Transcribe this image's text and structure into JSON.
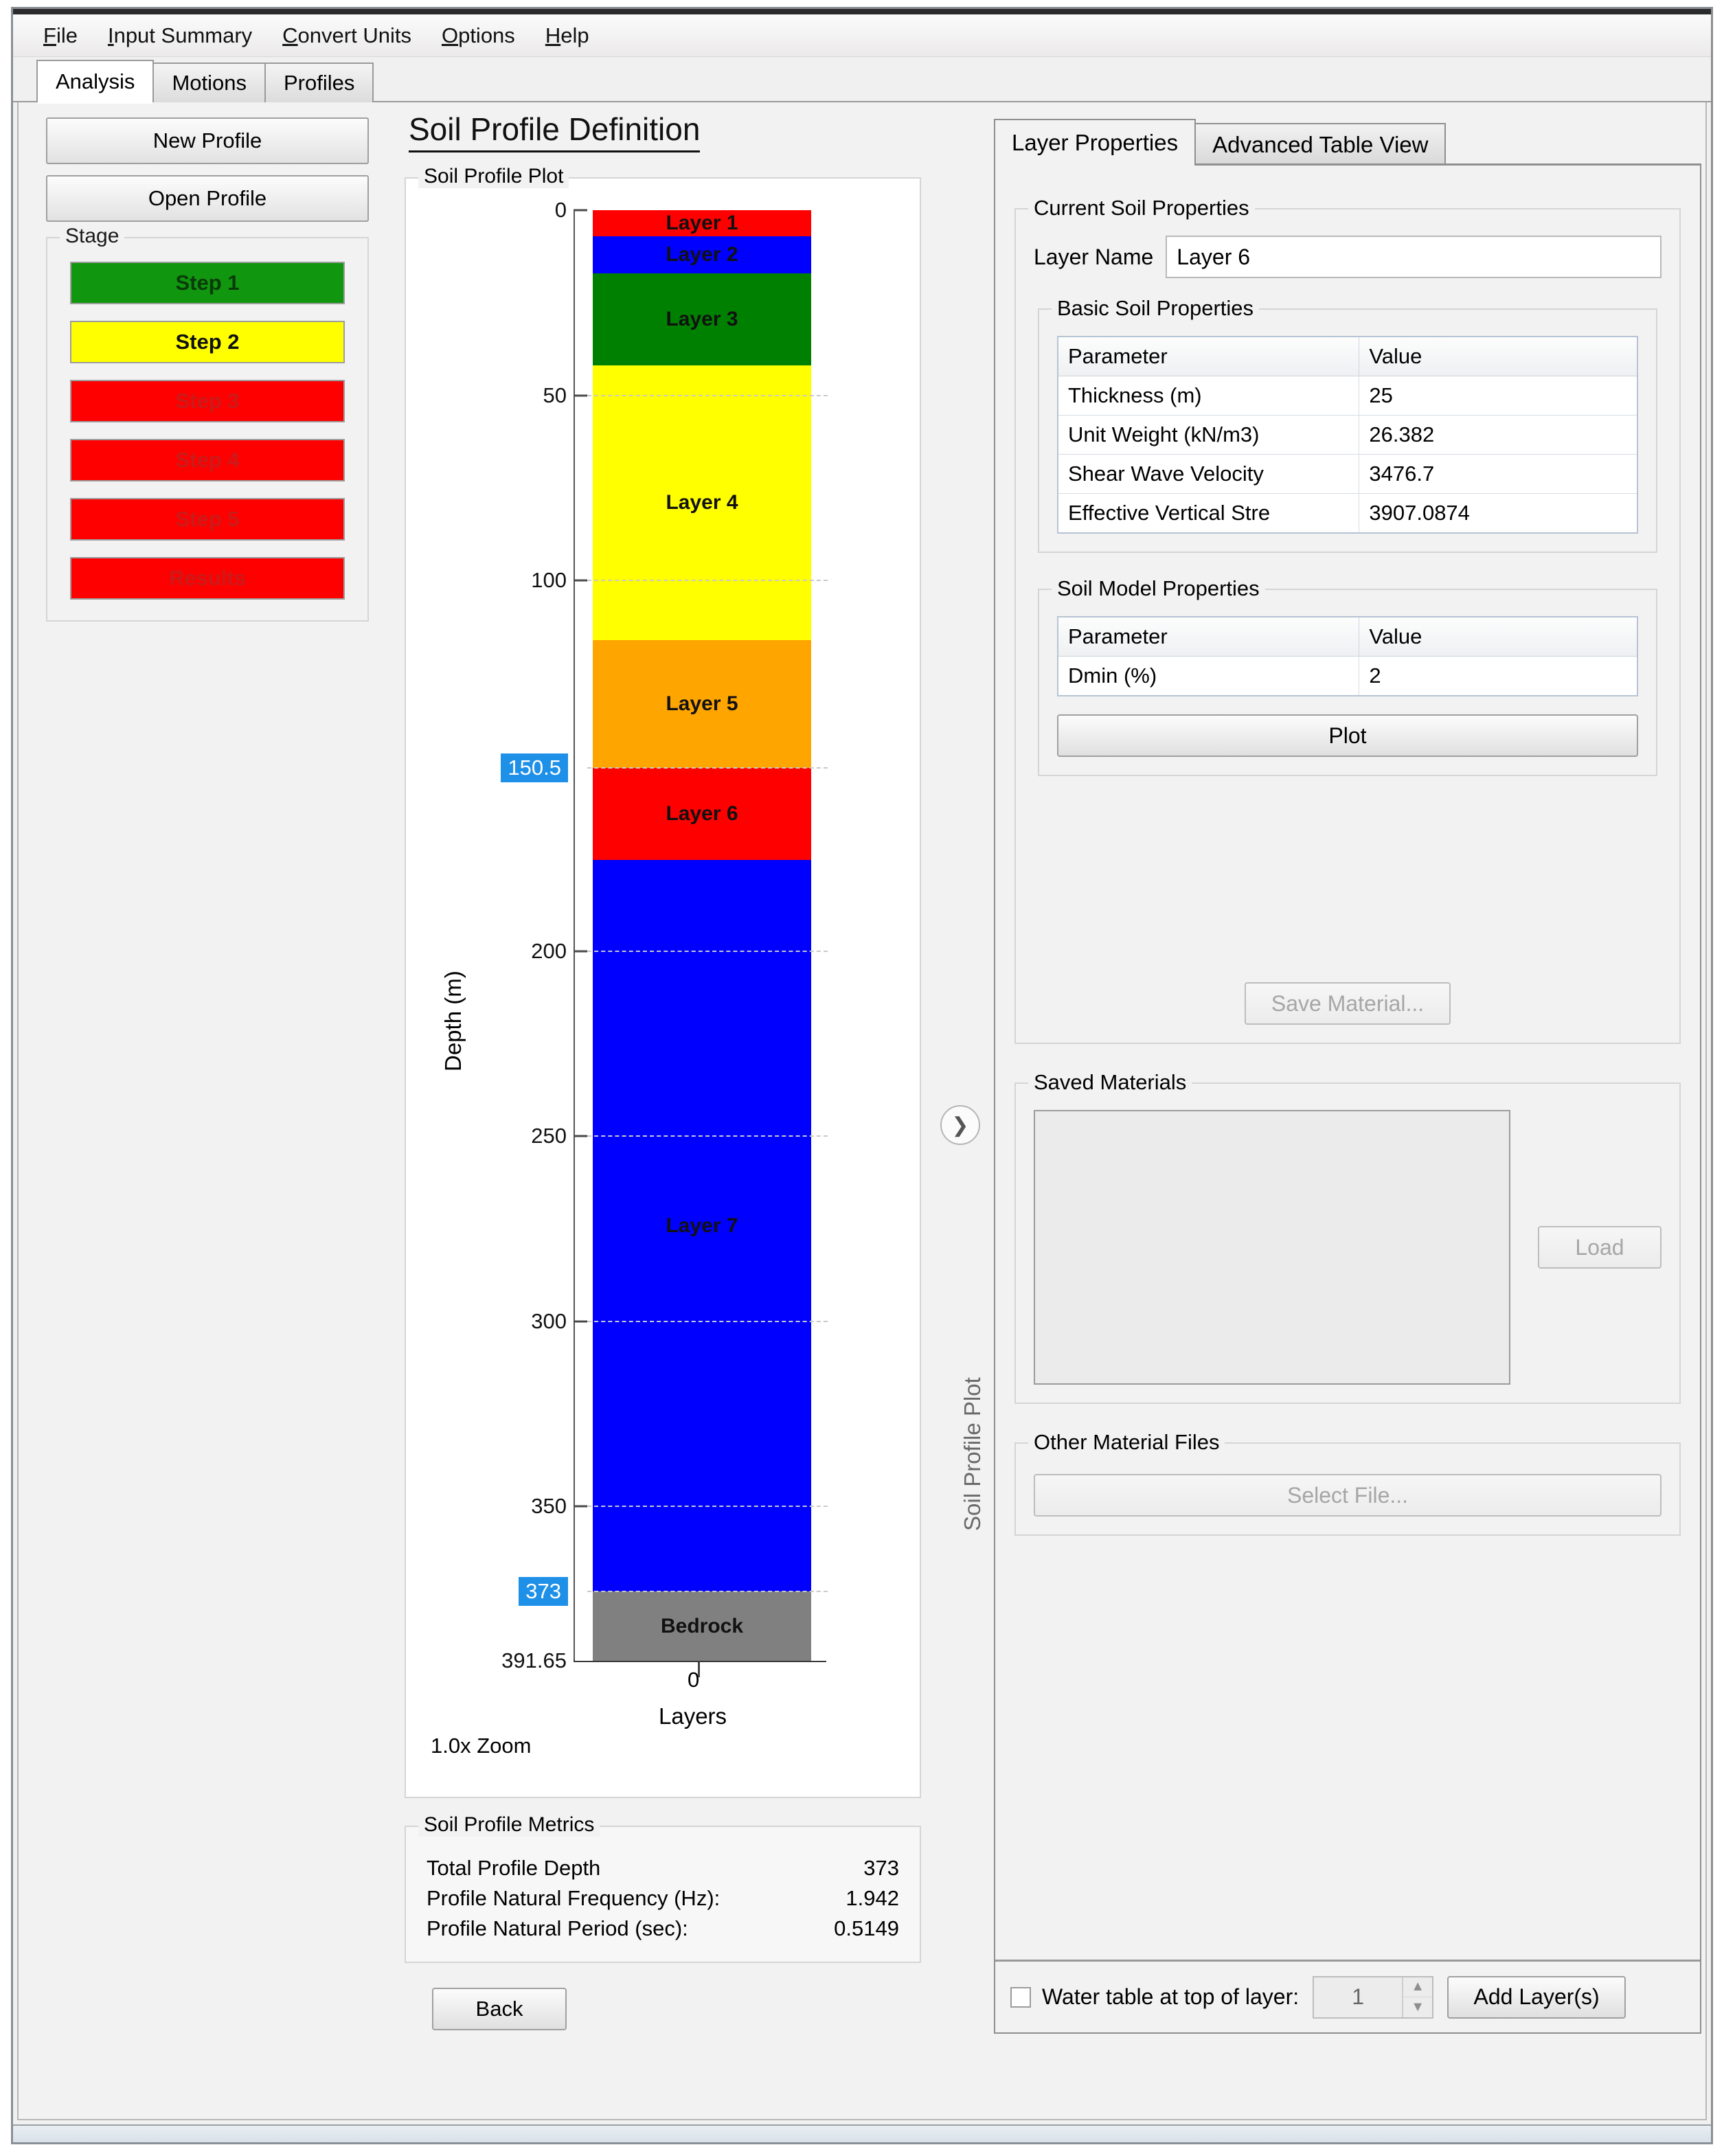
{
  "menubar": {
    "items": [
      {
        "label": "File",
        "mnemonic": "F"
      },
      {
        "label": "Input Summary",
        "mnemonic": "I"
      },
      {
        "label": "Convert Units",
        "mnemonic": "C"
      },
      {
        "label": "Options",
        "mnemonic": "O"
      },
      {
        "label": "Help",
        "mnemonic": "H"
      }
    ]
  },
  "tabs": [
    {
      "label": "Analysis",
      "active": true
    },
    {
      "label": "Motions",
      "active": false
    },
    {
      "label": "Profiles",
      "active": false
    }
  ],
  "sidebar": {
    "new_profile_label": "New Profile",
    "open_profile_label": "Open Profile",
    "stage_group_title": "Stage",
    "steps": [
      {
        "label": "Step 1",
        "color": "#10960f",
        "state": "green"
      },
      {
        "label": "Step 2",
        "color": "#ffff00",
        "state": "yellow"
      },
      {
        "label": "Step 3",
        "color": "#fe0000",
        "state": "red"
      },
      {
        "label": "Step 4",
        "color": "#fe0000",
        "state": "red"
      },
      {
        "label": "Step 5",
        "color": "#fe0000",
        "state": "red"
      },
      {
        "label": "Results",
        "color": "#fe0000",
        "state": "red"
      }
    ]
  },
  "page": {
    "title": "Soil Profile Definition"
  },
  "plot": {
    "group_title": "Soil Profile Plot",
    "zoom_label": "1.0x Zoom",
    "x_tick_label": "0",
    "x_axis_label": "Layers",
    "y_axis_label": "Depth (m)"
  },
  "chart_data": {
    "type": "bar",
    "title": "Soil Profile Plot",
    "xlabel": "Layers",
    "ylabel": "Depth (m)",
    "ylim": [
      0,
      391.65
    ],
    "y_ticks": [
      "0",
      "50",
      "100",
      "200",
      "250",
      "300",
      "350"
    ],
    "y_highlight_ticks": [
      "150.5",
      "373"
    ],
    "y_extra_tick": "391.65",
    "x_ticks": [
      "0"
    ],
    "grid": true,
    "legend": "none",
    "orientation": "vertical-depth",
    "layers": [
      {
        "name": "Layer 1",
        "top": 0,
        "bottom": 7,
        "color": "#fe0000"
      },
      {
        "name": "Layer 2",
        "top": 7,
        "bottom": 17,
        "color": "#0000ff"
      },
      {
        "name": "Layer 3",
        "top": 17,
        "bottom": 42,
        "color": "#008000"
      },
      {
        "name": "Layer 4",
        "top": 42,
        "bottom": 116,
        "color": "#ffff00"
      },
      {
        "name": "Layer 5",
        "top": 116,
        "bottom": 150.5,
        "color": "#ffa500"
      },
      {
        "name": "Layer 6",
        "top": 150.5,
        "bottom": 175.5,
        "color": "#fe0000"
      },
      {
        "name": "Layer 7",
        "top": 175.5,
        "bottom": 373,
        "color": "#0000ff"
      },
      {
        "name": "Bedrock",
        "top": 373,
        "bottom": 391.65,
        "color": "#808080"
      }
    ]
  },
  "metrics": {
    "group_title": "Soil Profile Metrics",
    "rows": [
      {
        "label": "Total Profile Depth",
        "value": "373"
      },
      {
        "label": "Profile Natural Frequency (Hz):",
        "value": "1.942"
      },
      {
        "label": "Profile Natural Period (sec):",
        "value": "0.5149"
      }
    ]
  },
  "back_button": "Back",
  "splitter": {
    "label": "Soil Profile Plot",
    "collapse_icon": "chevron-right"
  },
  "right": {
    "tabs": [
      {
        "label": "Layer Properties",
        "active": true
      },
      {
        "label": "Advanced Table View",
        "active": false
      }
    ],
    "current_soil_properties": {
      "group_title": "Current Soil Properties",
      "layer_name_label": "Layer Name",
      "layer_name_value": "Layer 6",
      "basic_group_title": "Basic Soil Properties",
      "basic_headers": [
        "Parameter",
        "Value"
      ],
      "basic_rows": [
        {
          "parameter": "Thickness (m)",
          "value": "25"
        },
        {
          "parameter": "Unit Weight (kN/m3)",
          "value": "26.382"
        },
        {
          "parameter": "Shear Wave Velocity",
          "value": "3476.7"
        },
        {
          "parameter": "Effective Vertical Stre",
          "value": "3907.0874"
        }
      ],
      "model_group_title": "Soil Model Properties",
      "model_headers": [
        "Parameter",
        "Value"
      ],
      "model_rows": [
        {
          "parameter": "Dmin (%)",
          "value": "2"
        }
      ],
      "plot_button": "Plot",
      "save_material_button": "Save Material..."
    },
    "saved_materials": {
      "group_title": "Saved Materials",
      "load_button": "Load",
      "items": []
    },
    "other_material_files": {
      "group_title": "Other Material Files",
      "select_file_button": "Select File..."
    },
    "bottom_bar": {
      "water_table_label": "Water table at top of layer:",
      "water_table_checked": false,
      "layer_spinner_value": "1",
      "add_layers_button": "Add Layer(s)"
    }
  },
  "colors": {
    "highlight_badge": "#1e90e8",
    "step_green": "#10960f",
    "step_yellow": "#ffff00",
    "step_red": "#fe0000"
  }
}
